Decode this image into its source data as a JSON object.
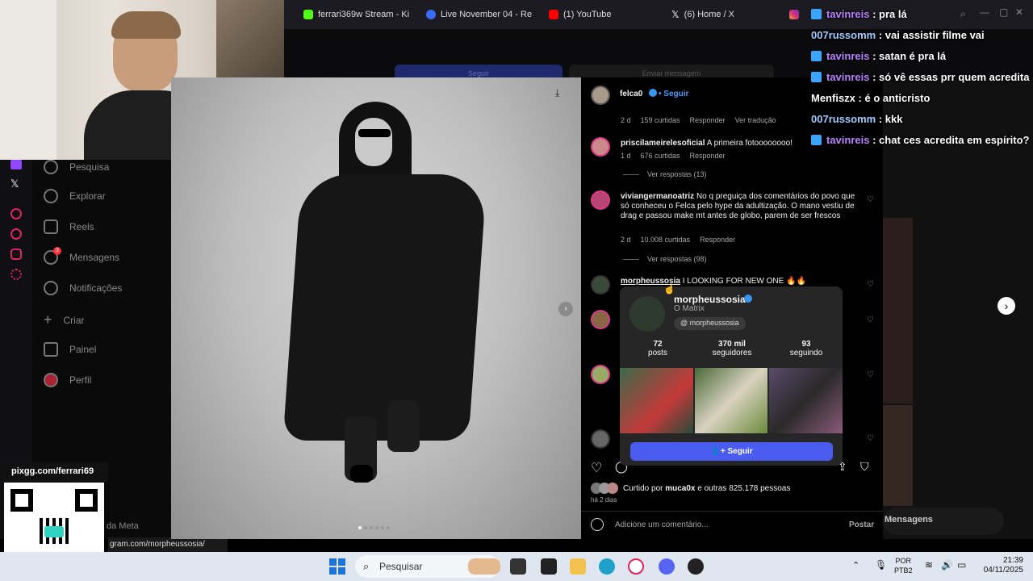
{
  "browser_tabs": [
    {
      "label": "ferrari369w Stream - Ki",
      "color": "#53fc18"
    },
    {
      "label": "Live November 04 - Re",
      "color": "#3a6cf4"
    },
    {
      "label": "(1) YouTube",
      "color": "#ff0000"
    },
    {
      "label": "(6) Home / X",
      "color": "#ffffff"
    }
  ],
  "ig_sidebar": {
    "items": [
      "Pesquisa",
      "Explorar",
      "Reels",
      "Mensagens",
      "Notificações",
      "Criar",
      "Painel",
      "Perfil"
    ],
    "messages_badge": "3",
    "footer": "da Meta"
  },
  "stream_overlay": {
    "url": "pixgg.com/ferrari69"
  },
  "status_url": "gram.com/morpheussosia/",
  "post": {
    "author": "felca0",
    "follow": "• Seguir",
    "comments": [
      {
        "time": "2 d",
        "likes": "159 curtidas",
        "reply": "Responder",
        "translate": "Ver tradução"
      },
      {
        "user": "priscilameirelesoficial",
        "text": "A primeira fotoooooooo!",
        "time": "1 d",
        "likes": "676 curtidas",
        "reply": "Responder",
        "replies": "Ver respostas (13)"
      },
      {
        "user": "viviangermanoatriz",
        "text": "No q preguiça dos comentários do povo que só conheceu o Felca pelo hype da adultização. O mano vestiu de drag e passou make mt antes de globo, parem de ser frescos",
        "time": "2 d",
        "likes": "10.008 curtidas",
        "reply": "Responder",
        "replies": "Ver respostas (98)"
      },
      {
        "user": "morpheussosia",
        "text": "I LOOKING FOR NEW ONE 🔥🔥"
      }
    ],
    "liked_by": "Curtido por",
    "liked_user": "muca0x",
    "liked_rest": "e outras 825.178 pessoas",
    "date": "há 2 dias",
    "add_comment": "Adicione um comentário...",
    "post_button": "Postar"
  },
  "hover_card": {
    "username": "morpheussosia",
    "fullname": "O Matrix",
    "threads": "morpheussosia",
    "posts_n": "72",
    "posts_l": "posts",
    "followers_n": "370 mil",
    "followers_l": "seguidores",
    "following_n": "93",
    "following_l": "seguindo",
    "follow_button": "Seguir"
  },
  "behind_buttons": {
    "follow": "Seguir",
    "message": "Enviar mensagem"
  },
  "messages_pill": "Mensagens",
  "chat": [
    {
      "user": "tavinreis",
      "msg": ": pra lá",
      "color": "#b980ff",
      "badge": true
    },
    {
      "user": "007russomm",
      "msg": ": vai assistir filme vai",
      "color": "#9ecbff",
      "badge": false
    },
    {
      "user": "tavinreis",
      "msg": ": satan é pra lá",
      "color": "#b980ff",
      "badge": true
    },
    {
      "user": "tavinreis",
      "msg": ": só vê essas prr quem acredita",
      "color": "#b980ff",
      "badge": true
    },
    {
      "user": "Menfiszx",
      "msg": ": é o anticristo",
      "color": "#ffffff",
      "badge": false
    },
    {
      "user": "007russomm",
      "msg": ": kkk",
      "color": "#9ecbff",
      "badge": false
    },
    {
      "user": "tavinreis",
      "msg": ": chat ces acredita em espírito?",
      "color": "#b980ff",
      "badge": true
    }
  ],
  "taskbar": {
    "search": "Pesquisar",
    "lang1": "POR",
    "lang2": "PTB2",
    "time": "21:39",
    "date": "04/11/2025"
  }
}
